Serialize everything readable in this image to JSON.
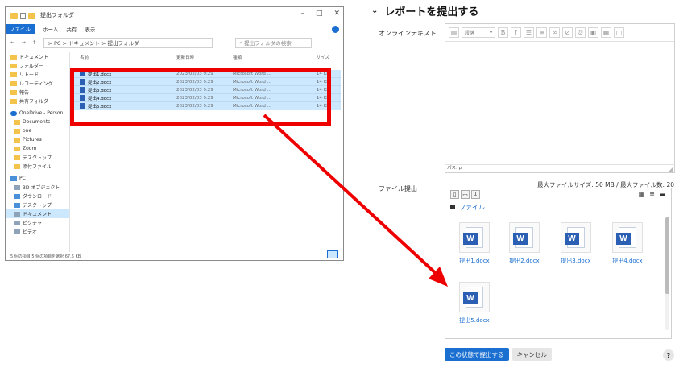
{
  "explorer": {
    "title": "提出フォルダ",
    "ribbon": {
      "file": "ファイル",
      "home": "ホーム",
      "share": "共有",
      "view": "表示"
    },
    "window_buttons": [
      "–",
      "□",
      "✕"
    ],
    "nav_arrows": "← → ↑",
    "address": "> PC > ドキュメント > 提出フォルダ",
    "search_placeholder": "提出フォルダの検索",
    "sidebar": [
      {
        "label": "ドキュメント",
        "icon": "folder-icon"
      },
      {
        "label": "フォルダー",
        "icon": "folder-icon"
      },
      {
        "label": "リトード",
        "icon": "folder-icon"
      },
      {
        "label": "レコーディング",
        "icon": "folder-icon"
      },
      {
        "label": "報告",
        "icon": "folder-icon"
      },
      {
        "label": "共有フォルダ",
        "icon": "folder-icon"
      },
      {
        "label": "OneDrive - Person",
        "icon": "cloud-icon"
      },
      {
        "label": "Documents",
        "icon": "folder-icon"
      },
      {
        "label": "one",
        "icon": "folder-icon"
      },
      {
        "label": "Pictures",
        "icon": "folder-icon"
      },
      {
        "label": "Zoom",
        "icon": "folder-icon"
      },
      {
        "label": "デスクトップ",
        "icon": "folder-icon"
      },
      {
        "label": "添付ファイル",
        "icon": "folder-icon"
      },
      {
        "label": "PC",
        "icon": "pc-icon"
      },
      {
        "label": "3D オブジェクト",
        "icon": "cube-icon"
      },
      {
        "label": "ダウンロード",
        "icon": "download-icon"
      },
      {
        "label": "デスクトップ",
        "icon": "desktop-icon"
      },
      {
        "label": "ドキュメント",
        "icon": "document-icon"
      },
      {
        "label": "ピクチャ",
        "icon": "picture-icon"
      },
      {
        "label": "ビデオ",
        "icon": "video-icon"
      }
    ],
    "columns": {
      "name": "名前",
      "date": "更新日時",
      "type": "種類",
      "size": "サイズ"
    },
    "files": [
      {
        "name": "提出1.docx",
        "date": "2023/02/03 9:29",
        "type": "Microsoft Word ...",
        "size": "14 KB"
      },
      {
        "name": "提出2.docx",
        "date": "2023/02/03 9:29",
        "type": "Microsoft Word ...",
        "size": "14 KB"
      },
      {
        "name": "提出3.docx",
        "date": "2023/02/03 9:29",
        "type": "Microsoft Word ...",
        "size": "14 KB"
      },
      {
        "name": "提出4.docx",
        "date": "2023/02/03 9:29",
        "type": "Microsoft Word ...",
        "size": "14 KB"
      },
      {
        "name": "提出5.docx",
        "date": "2023/02/03 9:29",
        "type": "Microsoft Word ...",
        "size": "14 KB"
      }
    ],
    "status": "5 個の項目   5 個の項目を選択  67.6 KB"
  },
  "moodle": {
    "section_title": "レポートを提出する",
    "online_text_label": "オンラインテキスト",
    "editor": {
      "paragraph_select": "段落",
      "bold": "B",
      "italic": "I",
      "path": "パス: p"
    },
    "file_submission_label": "ファイル提出",
    "file_limits": "最大ファイルサイズ: 50 MB / 最大ファイル数: 20",
    "folder_path": "ファイル",
    "files": [
      "提出1.docx",
      "提出2.docx",
      "提出3.docx",
      "提出4.docx",
      "提出5.docx"
    ],
    "submit_button": "この状態で提出する",
    "cancel_button": "キャンセル",
    "help": "?"
  },
  "colors": {
    "accent": "#1a6fd1",
    "highlight": "#ee0000",
    "selection": "#cce8ff"
  }
}
